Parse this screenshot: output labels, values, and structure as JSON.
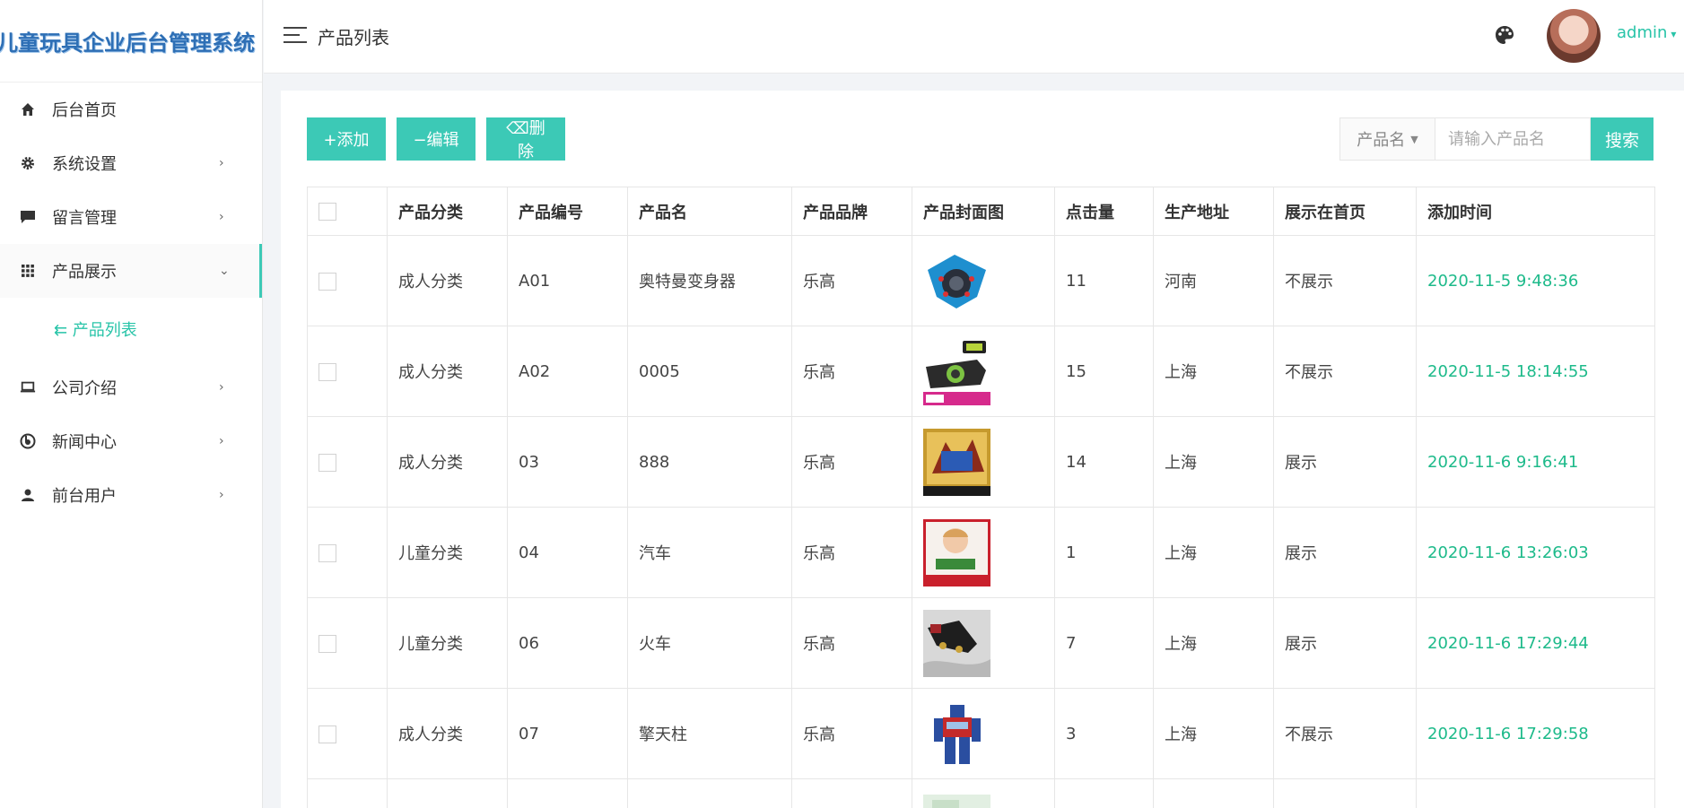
{
  "brand": {
    "title": "儿童玩具企业后台管理系统"
  },
  "sidebar": {
    "items": [
      {
        "label": "后台首页",
        "icon": "home-icon",
        "arrow": ""
      },
      {
        "label": "系统设置",
        "icon": "gear-icon",
        "arrow": "›"
      },
      {
        "label": "留言管理",
        "icon": "message-icon",
        "arrow": "›"
      },
      {
        "label": "产品展示",
        "icon": "grid-icon",
        "arrow": "⌄"
      },
      {
        "label": "公司介绍",
        "icon": "laptop-icon",
        "arrow": "›"
      },
      {
        "label": "新闻中心",
        "icon": "news-icon",
        "arrow": "›"
      },
      {
        "label": "前台用户",
        "icon": "user-icon",
        "arrow": "›"
      }
    ],
    "sub_item": {
      "label": "⇇ 产品列表"
    }
  },
  "header": {
    "title": "产品列表",
    "user": "admin"
  },
  "toolbar": {
    "add_label": "+添加",
    "edit_label": "−编辑",
    "delete_label": "⌫删除",
    "search_field": "产品名",
    "search_placeholder": "请输入产品名",
    "search_button": "搜索"
  },
  "table": {
    "columns": [
      "产品分类",
      "产品编号",
      "产品名",
      "产品品牌",
      "产品封面图",
      "点击量",
      "生产地址",
      "展示在首页",
      "添加时间"
    ],
    "rows": [
      {
        "category": "成人分类",
        "code": "A01",
        "name": "奥特曼变身器",
        "brand": "乐高",
        "clicks": "11",
        "address": "河南",
        "home": "不展示",
        "time": "2020-11-5 9:48:36",
        "image": "ultraman-transformer-image"
      },
      {
        "category": "成人分类",
        "code": "A02",
        "name": "0005",
        "brand": "乐高",
        "clicks": "15",
        "address": "上海",
        "home": "不展示",
        "time": "2020-11-5 18:14:55",
        "image": "belt-toy-image"
      },
      {
        "category": "成人分类",
        "code": "03",
        "name": "888",
        "brand": "乐高",
        "clicks": "14",
        "address": "上海",
        "home": "展示",
        "time": "2020-11-6 9:16:41",
        "image": "card-pack-image"
      },
      {
        "category": "儿童分类",
        "code": "04",
        "name": "汽车",
        "brand": "乐高",
        "clicks": "1",
        "address": "上海",
        "home": "展示",
        "time": "2020-11-6 13:26:03",
        "image": "child-car-image"
      },
      {
        "category": "儿童分类",
        "code": "06",
        "name": "火车",
        "brand": "乐高",
        "clicks": "7",
        "address": "上海",
        "home": "展示",
        "time": "2020-11-6 17:29:44",
        "image": "train-image"
      },
      {
        "category": "成人分类",
        "code": "07",
        "name": "擎天柱",
        "brand": "乐高",
        "clicks": "3",
        "address": "上海",
        "home": "不展示",
        "time": "2020-11-6 17:29:58",
        "image": "optimus-image"
      }
    ]
  },
  "colors": {
    "accent": "#3cc9b6",
    "time_green": "#1dba8a",
    "brand_blue": "#2e6fb5"
  }
}
